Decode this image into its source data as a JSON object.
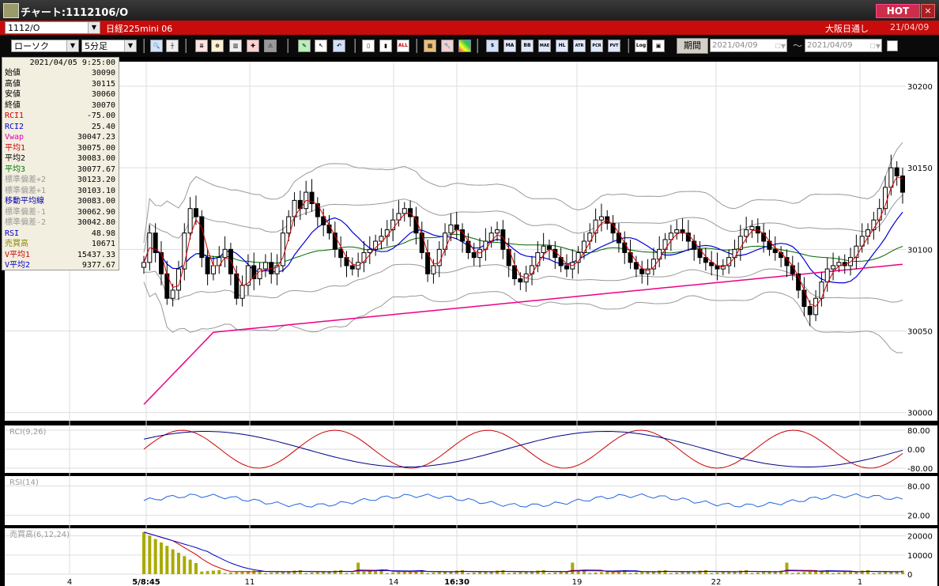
{
  "window": {
    "title": "チャート:1112106/O",
    "hot_label": "HOT",
    "close_label": "×"
  },
  "instrument_bar": {
    "symbol": "1112/O",
    "name": "日経225mini 06",
    "exchange": "大阪日通し",
    "date": "21/04/09"
  },
  "toolbar": {
    "chart_type": "ローソク",
    "interval": "5分足",
    "buttons": [
      "search",
      "cursor",
      "depth",
      "zoom",
      "bars",
      "chart-add",
      "warning",
      "pen",
      "arrow-select",
      "arrow-back",
      "candle-a",
      "candle-b",
      "ALL",
      "lattice",
      "wrench",
      "palette",
      "price",
      "MA",
      "BB",
      "MAE",
      "HL",
      "ATR",
      "PCR",
      "PVT",
      "Log",
      "export"
    ],
    "period_label": "期間",
    "date_from": "2021/04/09",
    "date_to": "2021/04/09",
    "tilde": "～"
  },
  "info_panel": {
    "datetime": "2021/04/05 9:25:00",
    "rows": [
      {
        "label": "始値",
        "value": "30090",
        "color": "#000000"
      },
      {
        "label": "高値",
        "value": "30115",
        "color": "#000000"
      },
      {
        "label": "安値",
        "value": "30060",
        "color": "#000000"
      },
      {
        "label": "終値",
        "value": "30070",
        "color": "#000000"
      },
      {
        "label": "RCI1",
        "value": "-75.00",
        "color": "#cc0000"
      },
      {
        "label": "RCI2",
        "value": "25.40",
        "color": "#0000cc"
      },
      {
        "label": "Vwap",
        "value": "30047.23",
        "color": "#dd00aa"
      },
      {
        "label": "平均1",
        "value": "30075.00",
        "color": "#cc0000"
      },
      {
        "label": "平均2",
        "value": "30083.00",
        "color": "#000000"
      },
      {
        "label": "平均3",
        "value": "30077.67",
        "color": "#007700"
      },
      {
        "label": "標準偏差+2",
        "value": "30123.20",
        "color": "#999999"
      },
      {
        "label": "標準偏差+1",
        "value": "30103.10",
        "color": "#999999"
      },
      {
        "label": "移動平均線",
        "value": "30083.00",
        "color": "#0000aa"
      },
      {
        "label": "標準偏差-1",
        "value": "30062.90",
        "color": "#999999"
      },
      {
        "label": "標準偏差-2",
        "value": "30042.80",
        "color": "#999999"
      },
      {
        "label": "RSI",
        "value": "48.98",
        "color": "#0000cc"
      },
      {
        "label": "売買高",
        "value": "10671",
        "color": "#888800"
      },
      {
        "label": "V平均1",
        "value": "15437.33",
        "color": "#cc0000"
      },
      {
        "label": "V平均2",
        "value": "9377.67",
        "color": "#0000cc"
      }
    ]
  },
  "chart_data": {
    "type": "candlestick",
    "price_axis": {
      "ticks": [
        "30200",
        "30150",
        "30100",
        "30050",
        "30000"
      ],
      "ylim": [
        29995,
        30215
      ]
    },
    "x_labels": [
      "4",
      "5/8:45",
      "11",
      "14",
      "16:30",
      "19",
      "22",
      "1"
    ],
    "panels": [
      {
        "label": "RCI(9,26)",
        "ticks": [
          "80.00",
          "0.00",
          "-80.00"
        ],
        "ylim": [
          -100,
          100
        ]
      },
      {
        "label": "RSI(14)",
        "ticks": [
          "80.00",
          "20.00"
        ],
        "ylim": [
          0,
          100
        ]
      },
      {
        "label": "売買高(6,12,24)",
        "ticks": [
          "20000",
          "10000",
          "0"
        ],
        "ylim": [
          0,
          24000
        ]
      }
    ],
    "colors": {
      "bg": "#ffffff",
      "grid": "#dddddd",
      "up": "#ffffff",
      "down": "#000000",
      "ma1": "#dd0000",
      "ma2": "#0000dd",
      "ma3": "#006600",
      "vwap": "#ee0088",
      "band": "#999999",
      "rci1": "#cc0000",
      "rci2": "#000088",
      "rsi": "#2266dd",
      "vol": "#aaaa00"
    },
    "price_series": [
      30092,
      30110,
      30098,
      30085,
      30070,
      30075,
      30088,
      30110,
      30125,
      30120,
      30095,
      30085,
      30090,
      30095,
      30100,
      30085,
      30070,
      30078,
      30090,
      30082,
      30088,
      30092,
      30085,
      30090,
      30110,
      30120,
      30130,
      30125,
      30135,
      30128,
      30120,
      30115,
      30110,
      30100,
      30095,
      30090,
      30088,
      30092,
      30098,
      30100,
      30105,
      30108,
      30112,
      30118,
      30122,
      30125,
      30120,
      30110,
      30098,
      30085,
      30090,
      30100,
      30110,
      30115,
      30112,
      30105,
      30098,
      30095,
      30100,
      30105,
      30110,
      30112,
      30100,
      30090,
      30082,
      30080,
      30085,
      30090,
      30098,
      30102,
      30100,
      30095,
      30090,
      30088,
      30092,
      30098,
      30105,
      30110,
      30118,
      30120,
      30116,
      30110,
      30104,
      30098,
      30092,
      30088,
      30085,
      30088,
      30094,
      30100,
      30106,
      30110,
      30112,
      30110,
      30105,
      30100,
      30095,
      30092,
      30090,
      30088,
      30090,
      30095,
      30100,
      30108,
      30112,
      30114,
      30110,
      30105,
      30100,
      30098,
      30095,
      30090,
      30085,
      30075,
      30065,
      30060,
      30070,
      30080,
      30088,
      30090,
      30092,
      30090,
      30095,
      30102,
      30108,
      30112,
      30118,
      30125,
      30138,
      30150,
      30145,
      30135
    ]
  }
}
